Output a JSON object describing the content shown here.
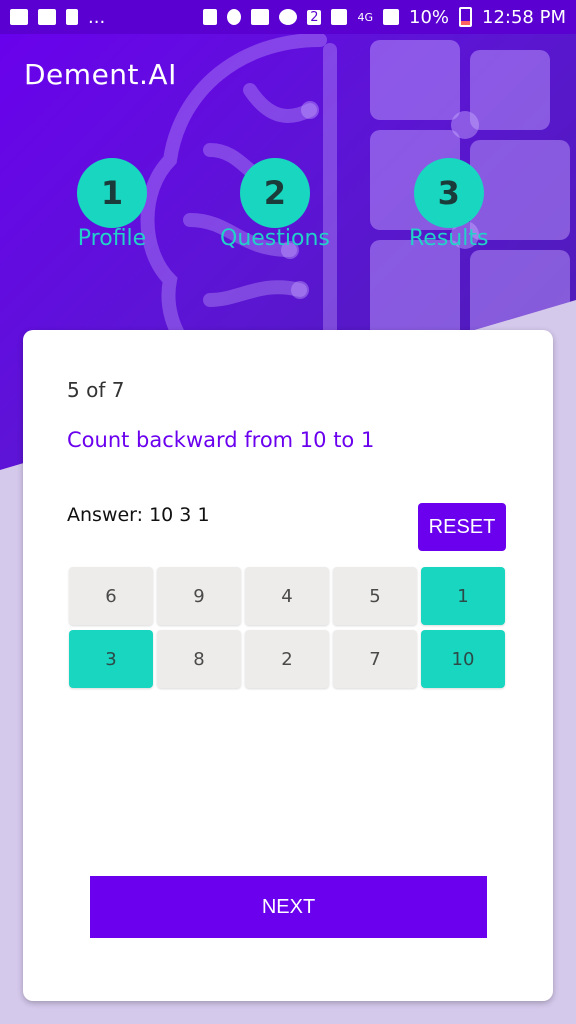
{
  "status_bar": {
    "battery": "10%",
    "time": "12:58 PM",
    "network_badge": "2",
    "network_type": "4G",
    "more": "..."
  },
  "app": {
    "title": "Dement.AI"
  },
  "steps": [
    {
      "number": "1",
      "label": "Profile"
    },
    {
      "number": "2",
      "label": "Questions"
    },
    {
      "number": "3",
      "label": "Results"
    }
  ],
  "quiz": {
    "progress_current": "5",
    "progress_of": "of",
    "progress_total": "7",
    "question": "Count backward from 10 to 1",
    "answer_label": "Answer:",
    "answer_value": "10 3 1",
    "reset_label": "RESET",
    "keys": [
      {
        "value": "6",
        "selected": false
      },
      {
        "value": "9",
        "selected": false
      },
      {
        "value": "4",
        "selected": false
      },
      {
        "value": "5",
        "selected": false
      },
      {
        "value": "1",
        "selected": true
      },
      {
        "value": "3",
        "selected": true
      },
      {
        "value": "8",
        "selected": false
      },
      {
        "value": "2",
        "selected": false
      },
      {
        "value": "7",
        "selected": false
      },
      {
        "value": "10",
        "selected": true
      }
    ],
    "next_label": "NEXT"
  },
  "colors": {
    "primary": "#6a00ee",
    "accent": "#18d6c0",
    "key_default": "#eeecea",
    "background": "#d4c8eb"
  }
}
